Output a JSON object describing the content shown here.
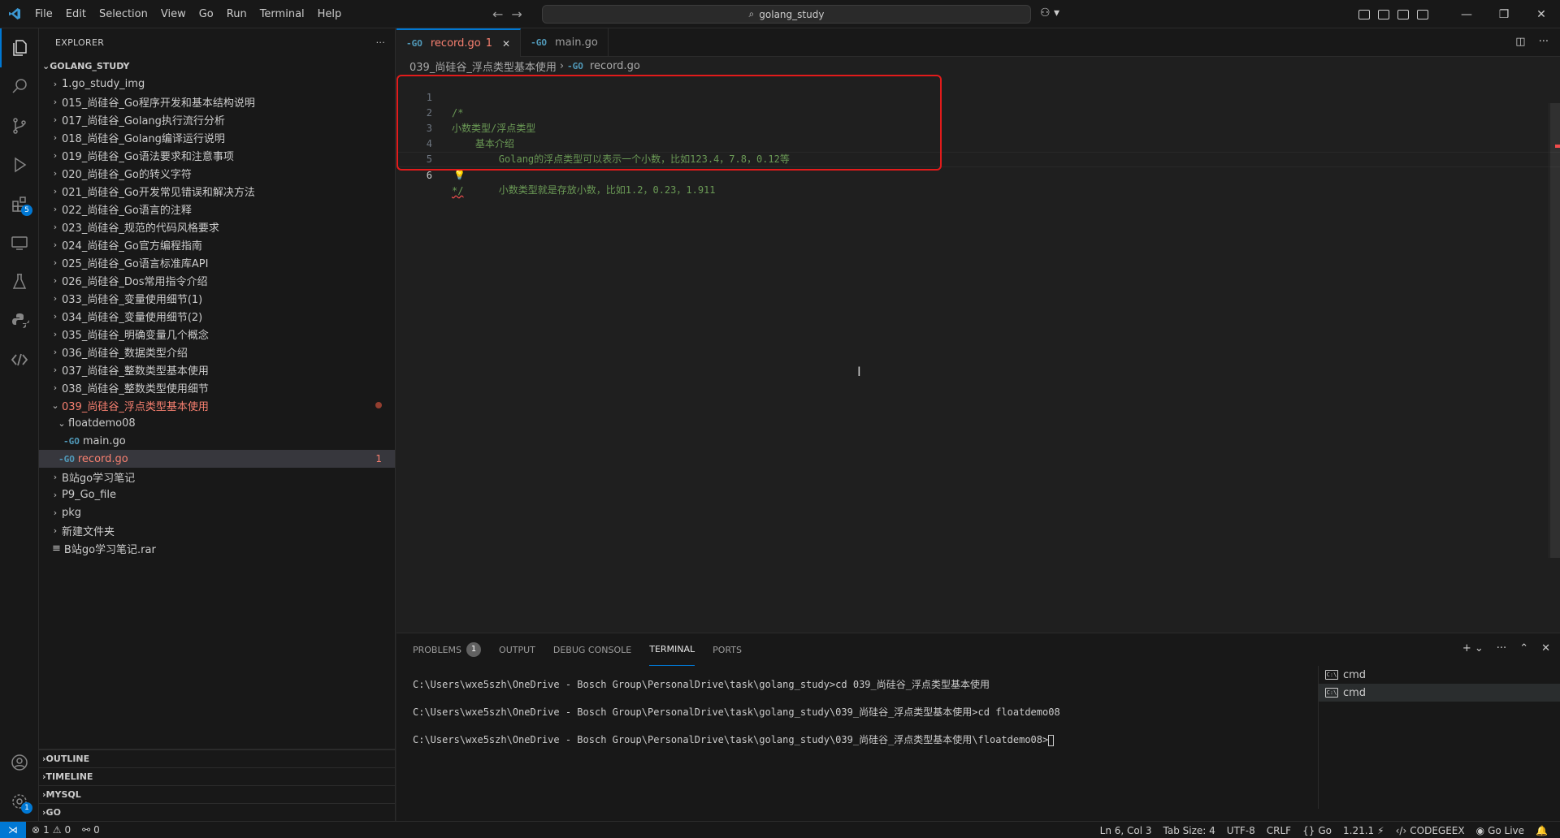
{
  "titlebar": {
    "menu": [
      "File",
      "Edit",
      "Selection",
      "View",
      "Go",
      "Run",
      "Terminal",
      "Help"
    ],
    "search_text": "golang_study"
  },
  "activity": {
    "extensions_badge": "5",
    "settings_badge": "1"
  },
  "sidebar": {
    "header": "EXPLORER",
    "more": "···",
    "root": "GOLANG_STUDY",
    "items": [
      {
        "label": "1.go_study_img"
      },
      {
        "label": "015_尚硅谷_Go程序开发和基本结构说明"
      },
      {
        "label": "017_尚硅谷_Golang执行流行分析"
      },
      {
        "label": "018_尚硅谷_Golang编译运行说明"
      },
      {
        "label": "019_尚硅谷_Go语法要求和注意事项"
      },
      {
        "label": "020_尚硅谷_Go的转义字符"
      },
      {
        "label": "021_尚硅谷_Go开发常见错误和解决方法"
      },
      {
        "label": "022_尚硅谷_Go语言的注释"
      },
      {
        "label": "023_尚硅谷_规范的代码风格要求"
      },
      {
        "label": "024_尚硅谷_Go官方编程指南"
      },
      {
        "label": "025_尚硅谷_Go语言标准库API"
      },
      {
        "label": "026_尚硅谷_Dos常用指令介绍"
      },
      {
        "label": "033_尚硅谷_变量使用细节(1)"
      },
      {
        "label": "034_尚硅谷_变量使用细节(2)"
      },
      {
        "label": "035_尚硅谷_明确变量几个概念"
      },
      {
        "label": "036_尚硅谷_数据类型介绍"
      },
      {
        "label": "037_尚硅谷_整数类型基本使用"
      },
      {
        "label": "038_尚硅谷_整数类型使用细节"
      }
    ],
    "open_folder": "039_尚硅谷_浮点类型基本使用",
    "subfolder": "floatdemo08",
    "file_main": "main.go",
    "file_record": "record.go",
    "record_problems": "1",
    "after_items": [
      {
        "label": "B站go学习笔记"
      },
      {
        "label": "P9_Go_file"
      },
      {
        "label": "pkg"
      },
      {
        "label": "新建文件夹"
      }
    ],
    "rar_file": "B站go学习笔记.rar",
    "sections": [
      "OUTLINE",
      "TIMELINE",
      "MYSQL",
      "GO"
    ]
  },
  "editor": {
    "tabs": [
      {
        "label": "record.go",
        "badge": "1"
      },
      {
        "label": "main.go"
      }
    ],
    "breadcrumb_folder": "039_尚硅谷_浮点类型基本使用",
    "breadcrumb_file": "record.go",
    "lines": [
      {
        "n": "1",
        "text": "/*"
      },
      {
        "n": "2",
        "text": "小数类型/浮点类型"
      },
      {
        "n": "3",
        "text": "    基本介绍"
      },
      {
        "n": "4",
        "text": "        Golang的浮点类型可以表示一个小数，比如123.4，7.8，0.12等"
      },
      {
        "n": "5",
        "text": "        小数类型就是存放小数，比如1.2，0.23，1.911"
      },
      {
        "n": "6",
        "text": "*/"
      }
    ]
  },
  "panel": {
    "tabs": [
      "PROBLEMS",
      "OUTPUT",
      "DEBUG CONSOLE",
      "TERMINAL",
      "PORTS"
    ],
    "problems_count": "1",
    "terminal_lines": [
      "C:\\Users\\wxe5szh\\OneDrive - Bosch Group\\PersonalDrive\\task\\golang_study>cd 039_尚硅谷_浮点类型基本使用",
      "C:\\Users\\wxe5szh\\OneDrive - Bosch Group\\PersonalDrive\\task\\golang_study\\039_尚硅谷_浮点类型基本使用>cd floatdemo08",
      "C:\\Users\\wxe5szh\\OneDrive - Bosch Group\\PersonalDrive\\task\\golang_study\\039_尚硅谷_浮点类型基本使用\\floatdemo08>"
    ],
    "terminals": [
      "cmd",
      "cmd"
    ]
  },
  "statusbar": {
    "errors": "1",
    "warnings": "0",
    "ports": "0",
    "position": "Ln 6, Col 3",
    "tab_size": "Tab Size: 4",
    "encoding": "UTF-8",
    "eol": "CRLF",
    "language": "Go",
    "go_version": "1.21.1",
    "codegeex": "CODEGEEX",
    "golive": "Go Live"
  },
  "colors": {
    "accent": "#0078d4",
    "error_text": "#f88070",
    "comment": "#6a9955",
    "highlight_box": "#e21b1b"
  }
}
